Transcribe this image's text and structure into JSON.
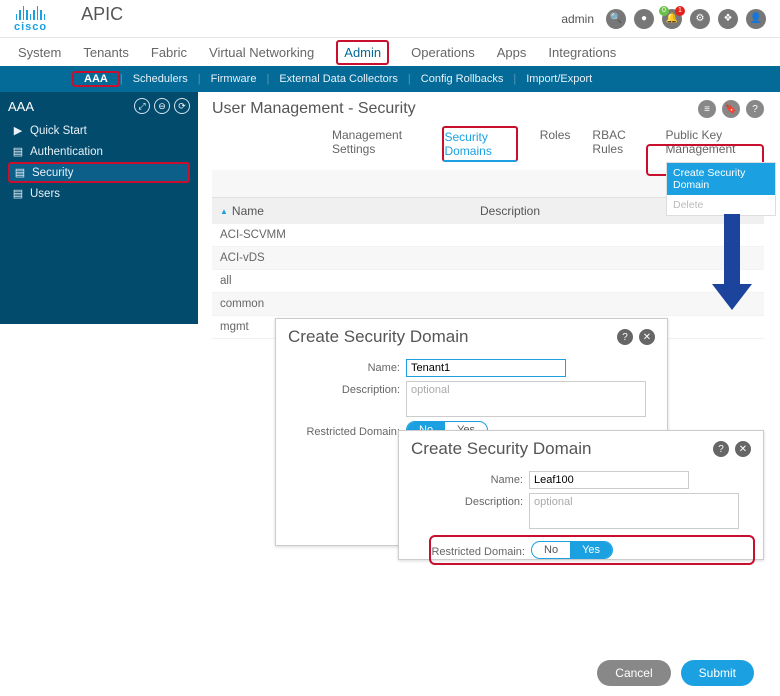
{
  "header": {
    "brand_word": "cisco",
    "app": "APIC",
    "user": "admin",
    "icons": [
      "search",
      "record",
      "bell",
      "gear",
      "apps",
      "user"
    ],
    "bell_badges": {
      "red": "1",
      "green": "0"
    }
  },
  "topnav": {
    "items": [
      "System",
      "Tenants",
      "Fabric",
      "Virtual Networking",
      "Admin",
      "Operations",
      "Apps",
      "Integrations"
    ],
    "active_index": 4
  },
  "subbar": {
    "items": [
      "AAA",
      "Schedulers",
      "Firmware",
      "External Data Collectors",
      "Config Rollbacks",
      "Import/Export"
    ],
    "active_index": 0
  },
  "sidebar": {
    "title": "AAA",
    "items": [
      {
        "label": "Quick Start",
        "icon": "play"
      },
      {
        "label": "Authentication",
        "icon": "folder"
      },
      {
        "label": "Security",
        "icon": "folder",
        "selected": true
      },
      {
        "label": "Users",
        "icon": "folder"
      }
    ]
  },
  "content": {
    "title": "User Management - Security",
    "tabs": [
      "Management Settings",
      "Security Domains",
      "Roles",
      "RBAC Rules",
      "Public Key Management"
    ],
    "active_tab_index": 1,
    "table": {
      "columns": [
        "Name",
        "Description"
      ],
      "rows": [
        {
          "name": "ACI-SCVMM",
          "desc": ""
        },
        {
          "name": "ACI-vDS",
          "desc": ""
        },
        {
          "name": "all",
          "desc": ""
        },
        {
          "name": "common",
          "desc": ""
        },
        {
          "name": "mgmt",
          "desc": ""
        }
      ]
    },
    "action_menu": {
      "create": "Create Security Domain",
      "delete": "Delete"
    }
  },
  "dialog1": {
    "title": "Create Security Domain",
    "labels": {
      "name": "Name:",
      "desc": "Description:",
      "restricted": "Restricted Domain:"
    },
    "name_value": "Tenant1",
    "desc_placeholder": "optional",
    "toggle": {
      "no": "No",
      "yes": "Yes",
      "selected": "no"
    }
  },
  "dialog2": {
    "title": "Create Security Domain",
    "labels": {
      "name": "Name:",
      "desc": "Description:",
      "restricted": "Restricted Domain:"
    },
    "name_value": "Leaf100",
    "desc_placeholder": "optional",
    "toggle": {
      "no": "No",
      "yes": "Yes",
      "selected": "yes"
    }
  },
  "footer": {
    "cancel": "Cancel",
    "submit": "Submit"
  }
}
